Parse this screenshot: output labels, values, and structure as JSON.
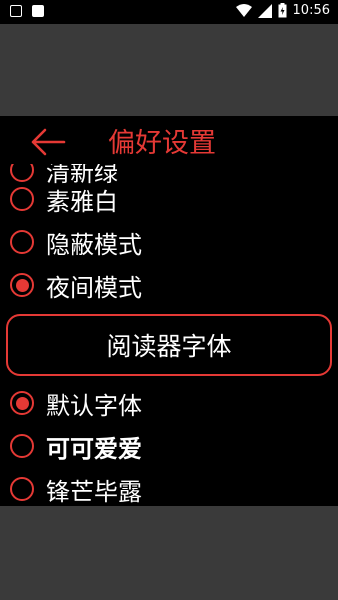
{
  "status_bar": {
    "time": "10:56"
  },
  "header": {
    "title": "偏好设置"
  },
  "theme_options": [
    {
      "label": "清新绿",
      "checked": false
    },
    {
      "label": "素雅白",
      "checked": false
    },
    {
      "label": "隐蔽模式",
      "checked": false
    },
    {
      "label": "夜间模式",
      "checked": true
    }
  ],
  "font_section": {
    "title": "阅读器字体"
  },
  "font_options": [
    {
      "label": "默认字体",
      "checked": true
    },
    {
      "label": "可可爱爱",
      "checked": false
    },
    {
      "label": "锋芒毕露",
      "checked": false
    }
  ],
  "colors": {
    "accent": "#e53935",
    "background": "#000000",
    "text": "#ffffff"
  }
}
